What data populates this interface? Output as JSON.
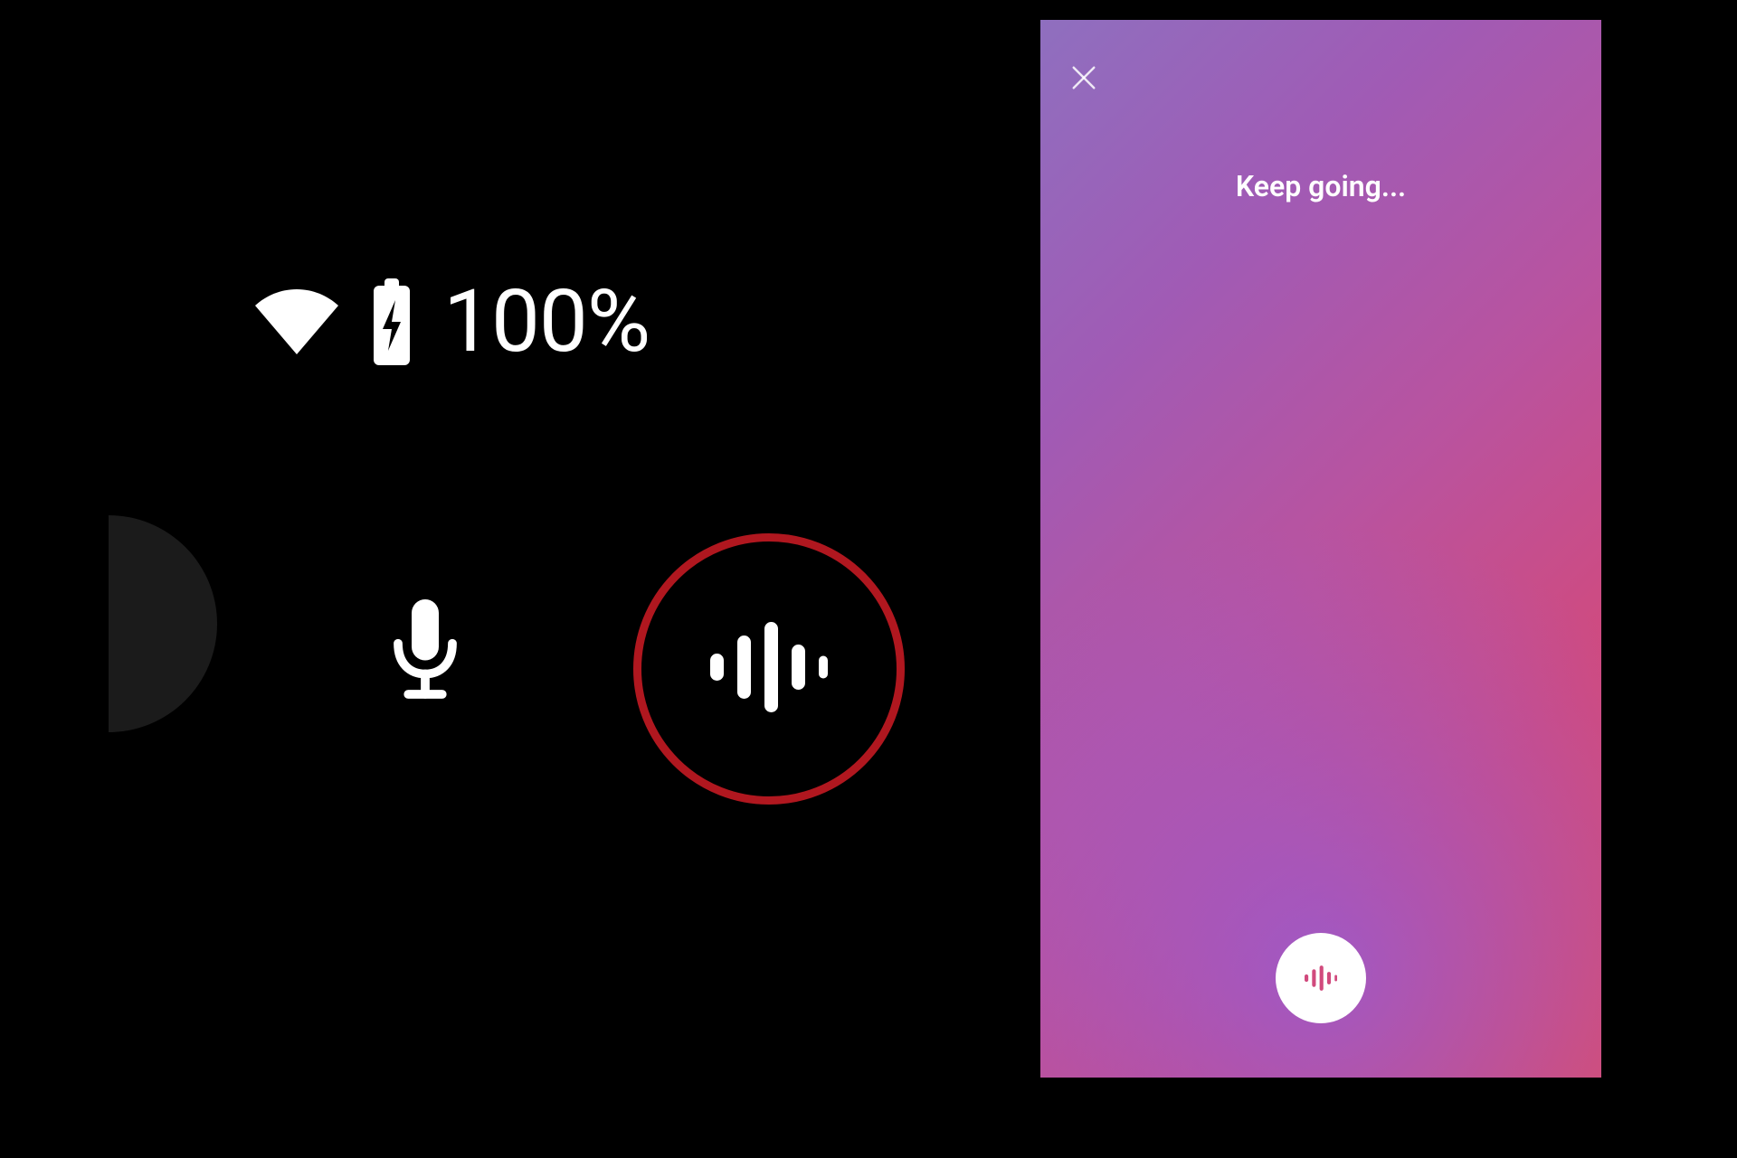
{
  "status": {
    "battery_text": "100%"
  },
  "phone": {
    "prompt": "Keep going...",
    "close_label": "Close"
  },
  "icons": {
    "wifi": "wifi-icon",
    "battery_charging": "battery-charging-icon",
    "microphone": "microphone-icon",
    "sound_wave": "sound-wave-icon",
    "close": "close-icon"
  },
  "colors": {
    "highlight_ring": "#b0171f",
    "panel_gradient_from": "#8f6fbf",
    "panel_gradient_to": "#e04a63"
  }
}
